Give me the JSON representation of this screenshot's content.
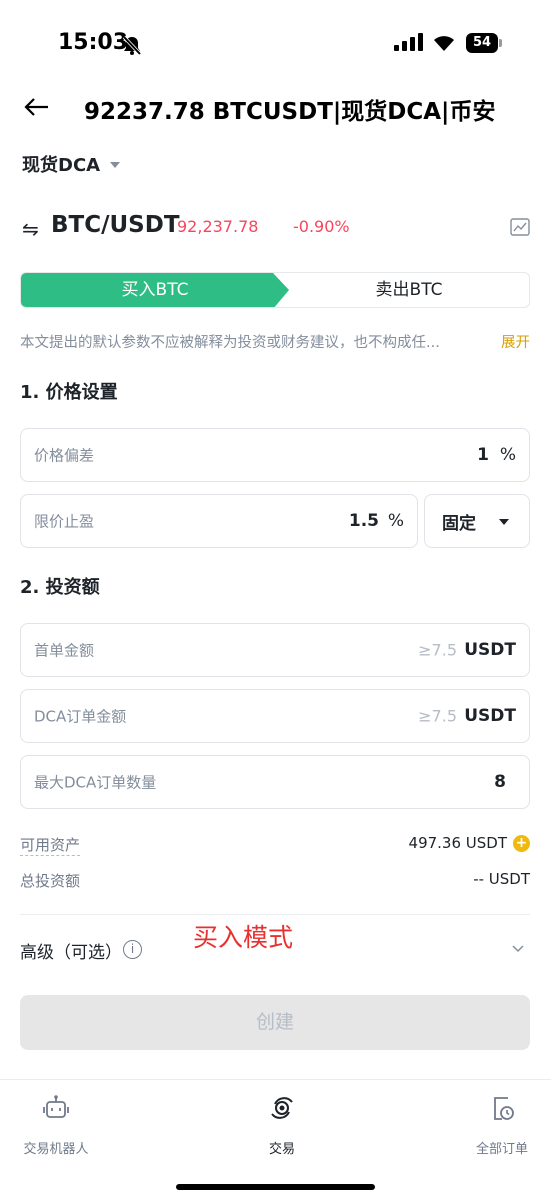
{
  "status_bar": {
    "time": "15:03",
    "battery": "54"
  },
  "nav": {
    "title": "92237.78 BTCUSDT|现货DCA|币安"
  },
  "strategy": {
    "label": "现货DCA"
  },
  "pair": {
    "name": "BTC/USDT",
    "price": "92,237.78",
    "change": "-0.90%"
  },
  "tabs": {
    "buy": "买入BTC",
    "sell": "卖出BTC"
  },
  "disclaimer": {
    "text": "本文提出的默认参数不应被解释为投资或财务建议，也不构成任...",
    "expand": "展开"
  },
  "price_settings": {
    "title": "1. 价格设置",
    "deviation_label": "价格偏差",
    "deviation_value": "1",
    "deviation_unit": "%",
    "take_profit_label": "限价止盈",
    "take_profit_value": "1.5",
    "take_profit_unit": "%",
    "mode_value": "固定"
  },
  "investment": {
    "title": "2. 投资额",
    "first_order_label": "首单金额",
    "first_order_hint": "≥7.5",
    "first_order_unit": "USDT",
    "dca_order_label": "DCA订单金额",
    "dca_order_hint": "≥7.5",
    "dca_order_unit": "USDT",
    "max_orders_label": "最大DCA订单数量",
    "max_orders_value": "8"
  },
  "assets": {
    "available_label": "可用资产",
    "available_value": "497.36 USDT",
    "total_label": "总投资额",
    "total_value": "-- USDT"
  },
  "advanced": {
    "label": "高级（可选）",
    "info": "i"
  },
  "annotation": "买入模式",
  "create_button": "创建",
  "bottom_nav": {
    "bots": "交易机器人",
    "trade": "交易",
    "orders": "全部订单"
  },
  "colors": {
    "buy_green": "#2ebd85",
    "down_red": "#f6465d",
    "accent_yellow": "#f0b90b",
    "annotation_red": "#e8312f"
  }
}
